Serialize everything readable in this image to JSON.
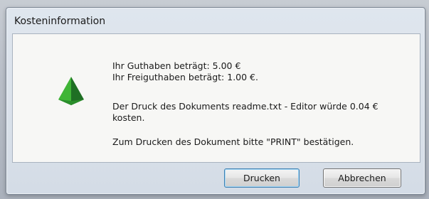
{
  "dialog": {
    "title": "Kosteninformation",
    "icon": "green-pyramid-icon",
    "messages": {
      "balance": "Ihr Guthaben beträgt: 5.00 €",
      "free_balance": "Ihr Freiguthaben beträgt: 1.00 €.",
      "cost": "Der Druck des Dokuments readme.txt - Editor würde 0.04 € kosten.",
      "confirm": "Zum Drucken des Dokument bitte \"PRINT\" bestätigen."
    },
    "buttons": {
      "print_label": "Drucken",
      "cancel_label": "Abbrechen"
    }
  },
  "colors": {
    "icon_green": "#3fb536",
    "icon_dark_green": "#1f6f24"
  }
}
